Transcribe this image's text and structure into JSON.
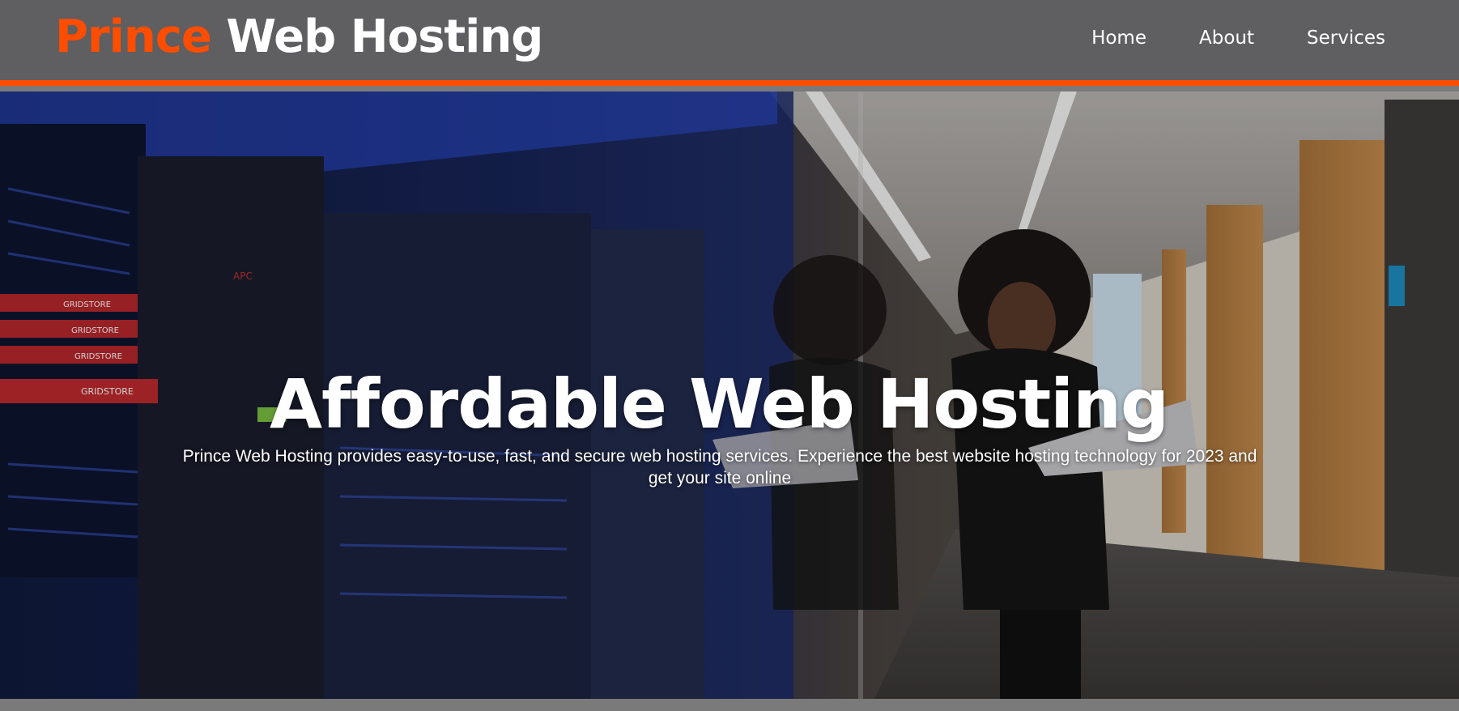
{
  "header": {
    "logo_accent": "Prince",
    "logo_rest": "Web Hosting",
    "nav": [
      {
        "label": "Home"
      },
      {
        "label": "About"
      },
      {
        "label": "Services"
      }
    ]
  },
  "hero": {
    "title": "Affordable Web Hosting",
    "subtitle": "Prince Web Hosting provides easy-to-use, fast, and secure web hosting services. Experience the best website hosting technology for 2023 and get your site online",
    "rack_label": "GRIDSTORE",
    "apc_label": "APC"
  },
  "colors": {
    "header_bg": "#5f5e60",
    "accent": "#ff4d00",
    "text": "#ffffff"
  }
}
